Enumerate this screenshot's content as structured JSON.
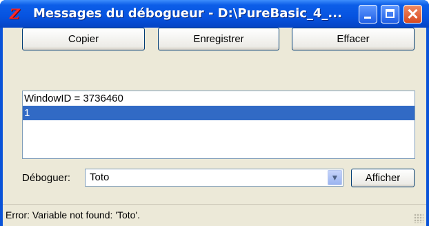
{
  "window": {
    "title": "Messages du débogueur - D:\\PureBasic_4_...",
    "app_icon": "purebasic-debugger-icon",
    "controls": {
      "minimize": "minimize-icon",
      "maximize": "maximize-icon",
      "close": "close-icon"
    }
  },
  "toolbar": {
    "copy_label": "Copier",
    "save_label": "Enregistrer",
    "clear_label": "Effacer"
  },
  "log": {
    "lines": [
      "WindowID = 3736460",
      "1"
    ],
    "selected_index": 1
  },
  "debug": {
    "label": "Déboguer:",
    "value": "Toto",
    "show_label": "Afficher"
  },
  "status": {
    "text": "Error: Variable not found: 'Toto'."
  },
  "colors": {
    "titlebar": "#0653e0",
    "selection": "#316ac5",
    "client": "#ece9d8"
  }
}
